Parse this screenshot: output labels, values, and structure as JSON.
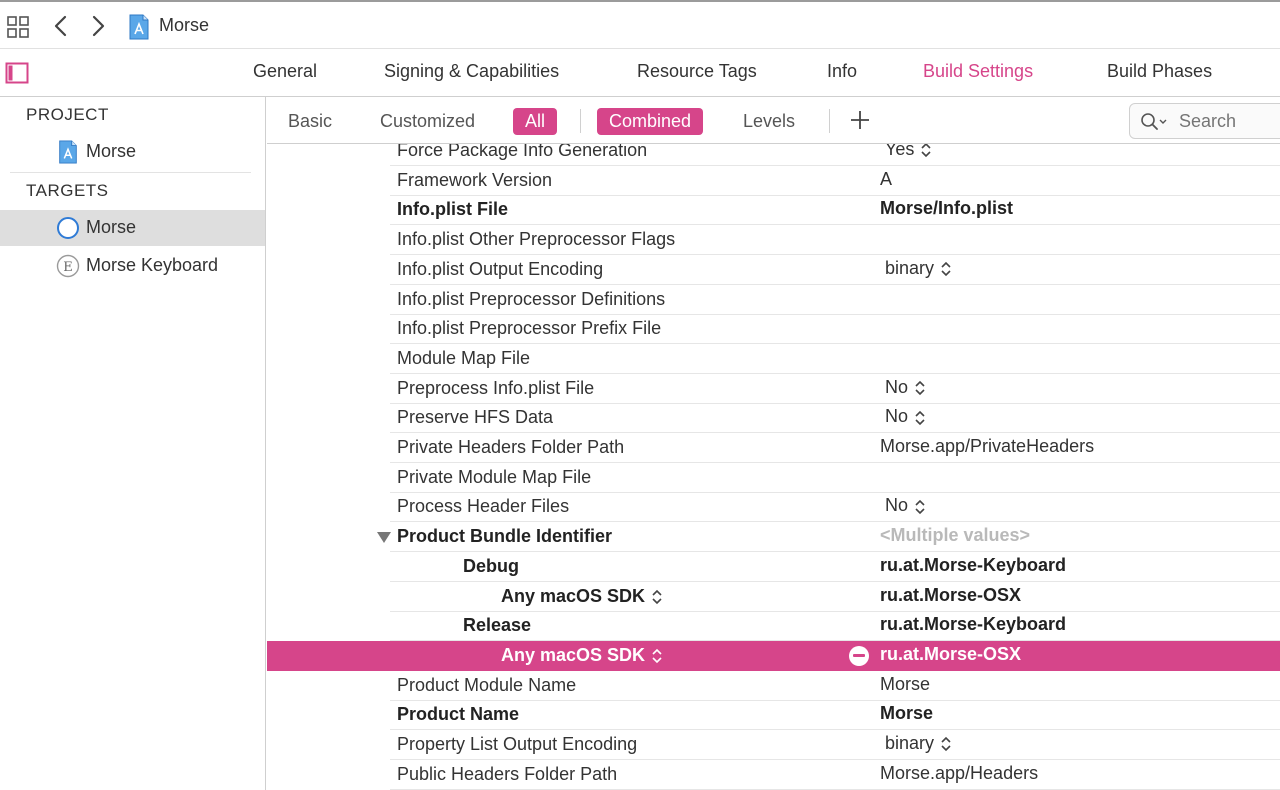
{
  "colors": {
    "accent": "#d6458a",
    "selection": "#dedede"
  },
  "topbar": {
    "breadcrumb": "Morse",
    "icons": [
      "grid-icon",
      "chevron-left-icon",
      "chevron-right-icon",
      "xcode-project-icon"
    ]
  },
  "tabs": [
    {
      "label": "General",
      "active": false
    },
    {
      "label": "Signing & Capabilities",
      "active": false
    },
    {
      "label": "Resource Tags",
      "active": false
    },
    {
      "label": "Info",
      "active": false
    },
    {
      "label": "Build Settings",
      "active": true
    },
    {
      "label": "Build Phases",
      "active": false
    }
  ],
  "sidebar": {
    "project_header": "PROJECT",
    "project_item": "Morse",
    "targets_header": "TARGETS",
    "targets": [
      {
        "label": "Morse",
        "selected": true,
        "icon": "app-target-icon"
      },
      {
        "label": "Morse Keyboard",
        "selected": false,
        "icon": "extension-target-icon"
      }
    ]
  },
  "filters": {
    "basic": "Basic",
    "customized": "Customized",
    "all": "All",
    "combined": "Combined",
    "levels": "Levels",
    "search_placeholder": "Search"
  },
  "settings": [
    {
      "name": "Force Package Info Generation",
      "value": "Yes",
      "popup": true
    },
    {
      "name": "Framework Version",
      "value": "A"
    },
    {
      "name": "Info.plist File",
      "value": "Morse/Info.plist",
      "bold": true
    },
    {
      "name": "Info.plist Other Preprocessor Flags",
      "value": ""
    },
    {
      "name": "Info.plist Output Encoding",
      "value": "binary",
      "popup": true
    },
    {
      "name": "Info.plist Preprocessor Definitions",
      "value": ""
    },
    {
      "name": "Info.plist Preprocessor Prefix File",
      "value": ""
    },
    {
      "name": "Module Map File",
      "value": ""
    },
    {
      "name": "Preprocess Info.plist File",
      "value": "No",
      "popup": true
    },
    {
      "name": "Preserve HFS Data",
      "value": "No",
      "popup": true
    },
    {
      "name": "Private Headers Folder Path",
      "value": "Morse.app/PrivateHeaders"
    },
    {
      "name": "Private Module Map File",
      "value": ""
    },
    {
      "name": "Process Header Files",
      "value": "No",
      "popup": true
    },
    {
      "name": "Product Bundle Identifier",
      "value": "<Multiple values>",
      "bold": true,
      "expanded": true,
      "muted": true
    },
    {
      "name": "Debug",
      "value": "ru.at.Morse-Keyboard",
      "bold": true,
      "level": 1
    },
    {
      "name": "Any macOS SDK",
      "value": "ru.at.Morse-OSX",
      "bold": true,
      "level": 2,
      "sdk_popup": true
    },
    {
      "name": "Release",
      "value": "ru.at.Morse-Keyboard",
      "bold": true,
      "level": 1
    },
    {
      "name": "Any macOS SDK",
      "value": "ru.at.Morse-OSX",
      "bold": true,
      "level": 2,
      "sdk_popup": true,
      "selected": true
    },
    {
      "name": "Product Module Name",
      "value": "Morse"
    },
    {
      "name": "Product Name",
      "value": "Morse",
      "bold": true
    },
    {
      "name": "Property List Output Encoding",
      "value": "binary",
      "popup": true
    },
    {
      "name": "Public Headers Folder Path",
      "value": "Morse.app/Headers"
    }
  ]
}
